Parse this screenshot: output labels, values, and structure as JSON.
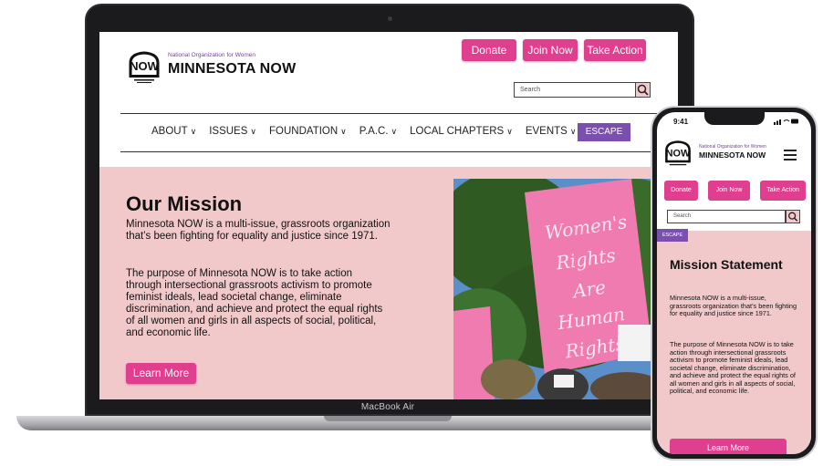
{
  "laptop": {
    "device_label": "MacBook Air",
    "site": {
      "org_name": "National Organization for Women",
      "brand": "MINNESOTA NOW",
      "buttons": {
        "donate": "Donate",
        "join": "Join Now",
        "take_action": "Take Action"
      },
      "search": {
        "placeholder": "Search"
      },
      "nav": [
        {
          "label": "ABOUT"
        },
        {
          "label": "ISSUES"
        },
        {
          "label": "FOUNDATION"
        },
        {
          "label": "P.A.C."
        },
        {
          "label": "LOCAL CHAPTERS"
        },
        {
          "label": "EVENTS"
        }
      ],
      "escape": "ESCAPE",
      "hero": {
        "title": "Our Mission",
        "p1": "Minnesota NOW is a multi-issue, grassroots organization that’s been fighting for equality and justice since 1971.",
        "p2": "The purpose of Minnesota NOW is to take action through intersectional grassroots activism to promote feminist ideals, lead societal change, eliminate discrimination, and achieve and protect the equal rights of all women and girls in all aspects of social, political, and economic life.",
        "learn_more": "Learn More",
        "sign_text": "Women's Rights Are Human Rights"
      }
    }
  },
  "phone": {
    "status": {
      "time": "9:41"
    },
    "site": {
      "org_name": "National Organization for Women",
      "brand": "MINNESOTA NOW",
      "buttons": {
        "donate": "Donate",
        "join": "Join Now",
        "take_action": "Take Action"
      },
      "search": {
        "placeholder": "Search"
      },
      "escape": "ESCAPE",
      "hero": {
        "title": "Mission Statement",
        "p1": "Minnesota NOW is a multi-issue, grassroots organization that’s been fighting for equality and justice since 1971.",
        "p2": "The purpose of Minnesota NOW is to take action through intersectional grassroots activism to promote feminist ideals, lead societal change, eliminate discrimination, and achieve and protect the equal rights of all women and girls in all aspects of social, political, and economic life.",
        "learn_more": "Learn More"
      }
    }
  },
  "colors": {
    "pink_button": "#e03e8e",
    "hero_background": "#f2c9cb",
    "escape_purple": "#7b4fb0",
    "org_name_purple": "#7b3fa0"
  },
  "icons": [
    "now-logo-icon",
    "search-icon",
    "chevron-down-icon",
    "hamburger-menu-icon"
  ]
}
